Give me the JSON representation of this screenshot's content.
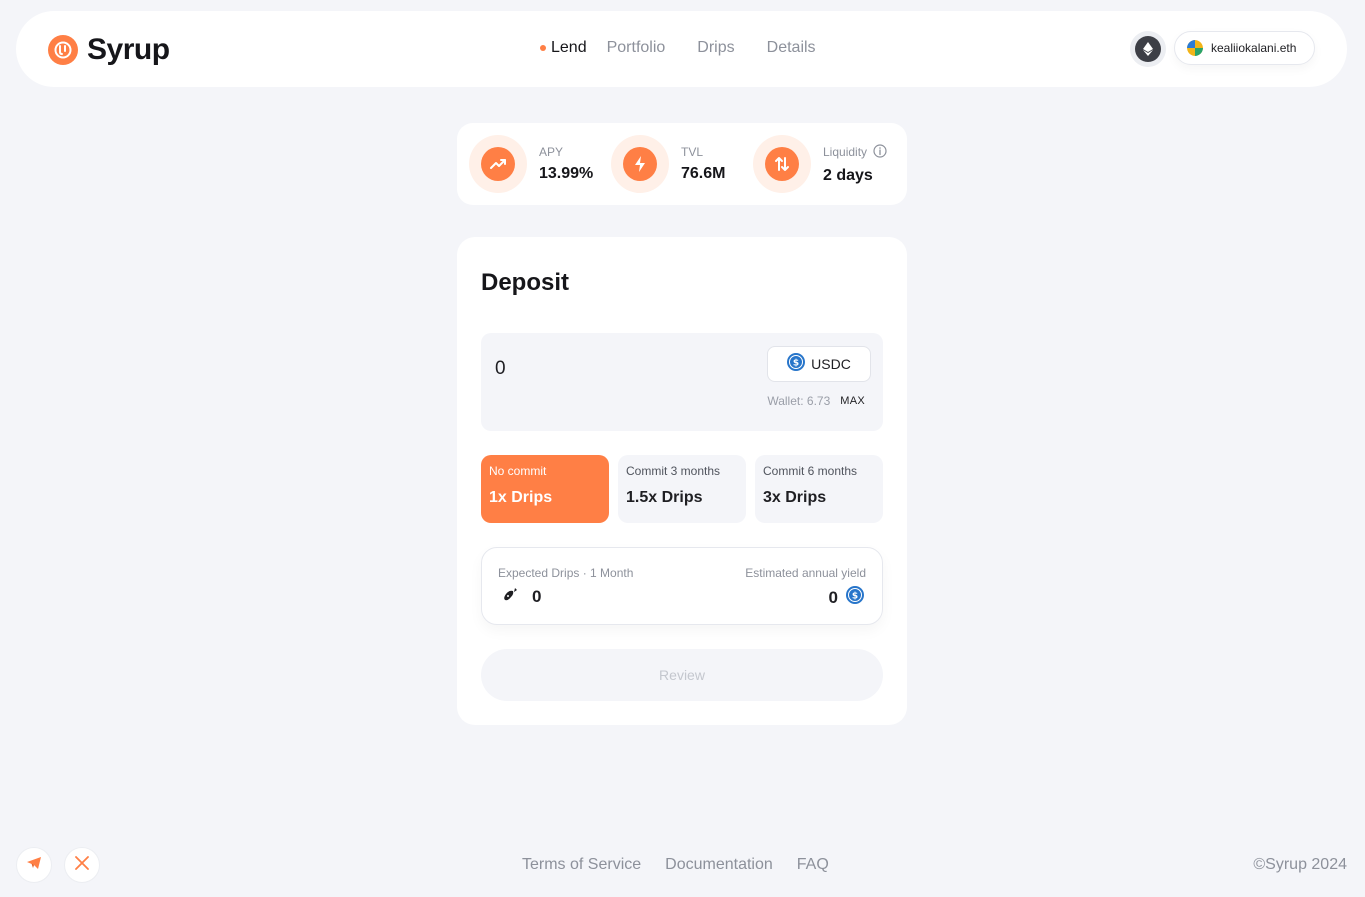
{
  "brand": {
    "name": "Syrup",
    "accent_color": "#ff7f45",
    "logo_icon": "syrup-drop-logo"
  },
  "nav": {
    "items": [
      {
        "label": "Lend",
        "active": true
      },
      {
        "label": "Portfolio",
        "active": false
      },
      {
        "label": "Drips",
        "active": false
      },
      {
        "label": "Details",
        "active": false
      }
    ]
  },
  "header": {
    "network_icon": "ethereum-icon",
    "wallet_name": "kealiiokalani.eth"
  },
  "stats": [
    {
      "label": "APY",
      "value": "13.99%",
      "icon": "trend-up-icon"
    },
    {
      "label": "TVL",
      "value": "76.6M",
      "icon": "lightning-icon"
    },
    {
      "label": "Liquidity",
      "value": "2 days",
      "icon": "arrows-up-down-icon",
      "info": true
    }
  ],
  "deposit": {
    "title": "Deposit",
    "amount_value": "0",
    "token": "USDC",
    "token_icon": "usdc-icon",
    "wallet_balance": "Wallet: 6.73",
    "max_label": "MAX"
  },
  "commit_options": [
    {
      "sub": "No commit",
      "main": "1x Drips",
      "selected": true
    },
    {
      "sub": "Commit 3 months",
      "main": "1.5x Drips",
      "selected": false
    },
    {
      "sub": "Commit 6 months",
      "main": "3x Drips",
      "selected": false
    }
  ],
  "expected": {
    "drips_label": "Expected Drips · 1 Month",
    "drips_value": "0",
    "yield_label": "Estimated annual yield",
    "yield_value": "0"
  },
  "review_label": "Review",
  "footer": {
    "social": [
      "telegram-icon",
      "x-icon"
    ],
    "links": [
      "Terms of Service",
      "Documentation",
      "FAQ"
    ],
    "copyright": "©Syrup 2024"
  }
}
